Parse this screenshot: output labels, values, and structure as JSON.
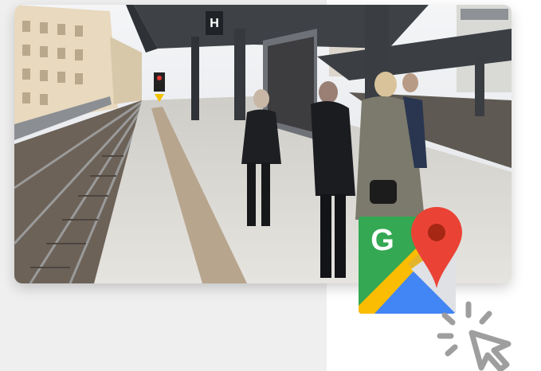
{
  "photo": {
    "description_icon": "street-view-photo",
    "sign_letter": "H"
  },
  "maps_icon": {
    "name": "google-maps-icon",
    "letter": "G",
    "colors": {
      "green": "#34a853",
      "blue": "#4285f4",
      "yellow": "#fbbc04",
      "red": "#ea4335",
      "pin_dot": "#a52714"
    }
  },
  "cursor": {
    "name": "click-cursor-icon",
    "color": "#9e9e9e"
  }
}
